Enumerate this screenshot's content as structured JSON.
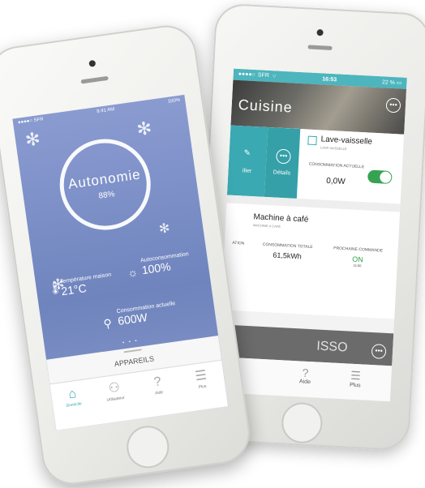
{
  "back_phone": {
    "status_bar": {
      "carrier": "SFR",
      "time": "16:53",
      "battery": "22 %"
    },
    "room_header": {
      "title": "Cuisine",
      "menu_icon": "ellipsis-icon"
    },
    "device_card": {
      "edit_label": "ifier",
      "details_label": "Détails",
      "title": "Lave-vaisselle",
      "subtitle": "LAVE-VAISSELLE",
      "consumption_label": "CONSOMMATION ACTUELLE",
      "consumption_value": "0,0W"
    },
    "coffee_card": {
      "title": "Machine à café",
      "subtitle": "MACHINE À CAFÉ",
      "col1_label": "ATION",
      "col2_label": "CONSOMMATION TOTALE",
      "col2_value": "61,5kWh",
      "col3_label": "PROCHAINE COMMANDE",
      "col3_state": "ON",
      "col3_time": "11:00",
      "toggle_on": true
    },
    "bottom_strip": {
      "text": "ISSO"
    },
    "tabbar": [
      {
        "label": "ur",
        "icon": "user-icon"
      },
      {
        "label": "Aide",
        "icon": "help-icon"
      },
      {
        "label": "Plus",
        "icon": "menu-icon"
      }
    ]
  },
  "front_phone": {
    "status_bar": {
      "carrier": "SFR",
      "time": "9:41 AM",
      "battery": "100%"
    },
    "ring": {
      "title": "Autonomie",
      "percent": "88%"
    },
    "metrics": [
      {
        "label": "Température maison",
        "value": "21°C",
        "icon": "thermometer-icon"
      },
      {
        "label": "Autoconsommation",
        "value": "100%",
        "icon": "sun-icon"
      },
      {
        "label": "Consommation actuelle",
        "value": "600W",
        "icon": "bulb-icon"
      }
    ],
    "pager": "• • •",
    "drawer_label": "APPAREILS",
    "tabbar": [
      {
        "label": "Domicile",
        "icon": "home-icon"
      },
      {
        "label": "Utilisateur",
        "icon": "user-icon"
      },
      {
        "label": "Aide",
        "icon": "help-icon"
      },
      {
        "label": "Plus",
        "icon": "menu-icon"
      }
    ]
  },
  "colors": {
    "accent": "#3aa9b2",
    "on_green": "#36a352",
    "sky": "#7d90c8"
  }
}
